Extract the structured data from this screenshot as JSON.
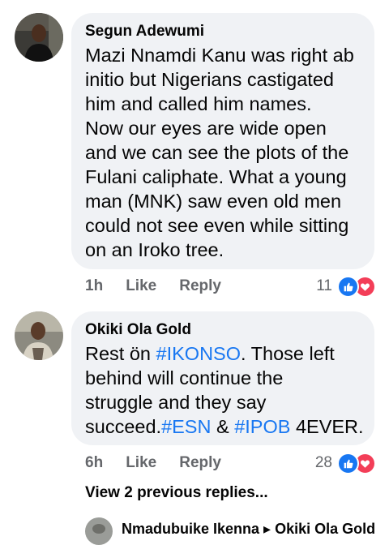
{
  "comments": [
    {
      "author": "Segun Adewumi",
      "lines": [
        "Mazi Nnamdi Kanu was right ab",
        "initio but Nigerians castigated",
        "him and called him names.",
        "Now our eyes are wide open",
        "and we can see the plots of the",
        "Fulani caliphate. What a young",
        "man (MNK) saw even old men",
        "could not see even while sitting",
        "on an Iroko tree."
      ],
      "time": "1h",
      "like_label": "Like",
      "reply_label": "Reply",
      "reaction_count": "11"
    },
    {
      "author": "Okiki Ola Gold",
      "line1_pre": "Rest ön ",
      "line1_tag": "#IKONSO",
      "line1_post": ". Those left",
      "line2": "behind will continue the",
      "line3": "struggle and they say",
      "line4_pre": "succeed.",
      "line4_tag1": "#ESN",
      "line4_mid": " & ",
      "line4_tag2": "#IPOB",
      "line4_post": " 4EVER.",
      "time": "6h",
      "like_label": "Like",
      "reply_label": "Reply",
      "reaction_count": "28"
    }
  ],
  "view_more": "View 2 previous replies...",
  "partial_reply": "Nmadubuike Ikenna ▸ Okiki Ola Gold",
  "icons": {
    "like": "thumbs-up-icon",
    "love": "heart-icon"
  },
  "colors": {
    "link": "#1877f2",
    "like": "#1877f2",
    "love": "#f33e58",
    "bubble": "#f0f2f5"
  }
}
